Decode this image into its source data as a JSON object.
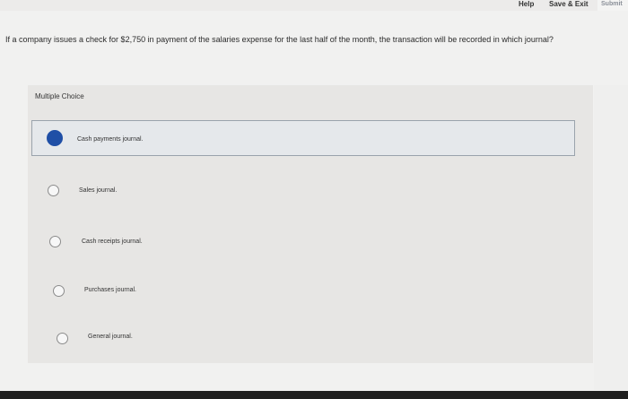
{
  "header": {
    "help_label": "Help",
    "save_exit_label": "Save & Exit",
    "submit_label": "Submit"
  },
  "question": {
    "text": "If a company issues a check for $2,750 in payment of the salaries expense for the last half of the month, the transaction will be recorded in which journal?"
  },
  "answer_panel": {
    "type_label": "Multiple Choice",
    "options": [
      {
        "label": "Cash payments journal.",
        "selected": true
      },
      {
        "label": "Sales journal.",
        "selected": false
      },
      {
        "label": "Cash receipts journal.",
        "selected": false
      },
      {
        "label": "Purchases journal.",
        "selected": false
      },
      {
        "label": "General journal.",
        "selected": false
      }
    ]
  },
  "colors": {
    "selected_radio": "#1f4fa6",
    "selected_border": "#9aa3ac"
  }
}
